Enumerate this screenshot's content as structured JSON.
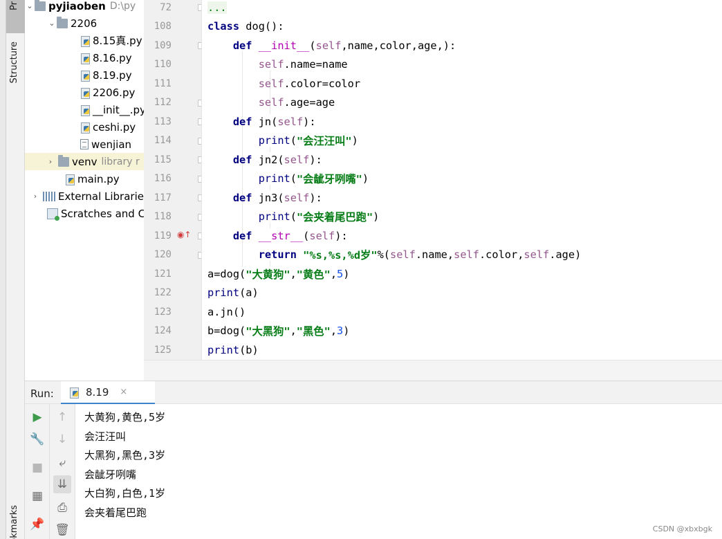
{
  "side_tabs": {
    "project": "Pr",
    "structure": "Structure",
    "bookmarks": "okmarks"
  },
  "project": {
    "root_name": "pyjiaoben",
    "root_path": "D:\\py",
    "folder_2206": "2206",
    "files": [
      "8.15真.py",
      "8.16.py",
      "8.19.py",
      "2206.py",
      "__init__.py",
      "ceshi.py",
      "wenjian"
    ],
    "venv": "venv",
    "venv_hint": "library r",
    "main": "main.py",
    "external": "External Librarie",
    "scratches": "Scratches and Co"
  },
  "editor": {
    "line_numbers": [
      "72",
      "108",
      "109",
      "110",
      "111",
      "112",
      "113",
      "114",
      "115",
      "116",
      "117",
      "118",
      "119",
      "120",
      "121",
      "122",
      "123",
      "124",
      "125"
    ],
    "lines": [
      [
        {
          "t": "...",
          "c": "dots"
        }
      ],
      [
        {
          "t": "class",
          "c": "kw"
        },
        {
          "t": " dog():",
          "c": ""
        }
      ],
      [
        {
          "t": "    ",
          "c": ""
        },
        {
          "t": "def",
          "c": "kw"
        },
        {
          "t": " ",
          "c": ""
        },
        {
          "t": "__init__",
          "c": "magic"
        },
        {
          "t": "(",
          "c": ""
        },
        {
          "t": "self",
          "c": "self"
        },
        {
          "t": ",name,color,age,):",
          "c": ""
        }
      ],
      [
        {
          "t": "        ",
          "c": ""
        },
        {
          "t": "self",
          "c": "self"
        },
        {
          "t": ".name=name",
          "c": ""
        }
      ],
      [
        {
          "t": "        ",
          "c": ""
        },
        {
          "t": "self",
          "c": "self"
        },
        {
          "t": ".color=color",
          "c": ""
        }
      ],
      [
        {
          "t": "        ",
          "c": ""
        },
        {
          "t": "self",
          "c": "self"
        },
        {
          "t": ".age=age",
          "c": ""
        }
      ],
      [
        {
          "t": "    ",
          "c": ""
        },
        {
          "t": "def",
          "c": "kw"
        },
        {
          "t": " jn(",
          "c": ""
        },
        {
          "t": "self",
          "c": "self"
        },
        {
          "t": "):",
          "c": ""
        }
      ],
      [
        {
          "t": "        ",
          "c": ""
        },
        {
          "t": "print",
          "c": "fn"
        },
        {
          "t": "(",
          "c": ""
        },
        {
          "t": "\"会汪汪叫\"",
          "c": "str"
        },
        {
          "t": ")",
          "c": ""
        }
      ],
      [
        {
          "t": "    ",
          "c": ""
        },
        {
          "t": "def",
          "c": "kw"
        },
        {
          "t": " jn2(",
          "c": ""
        },
        {
          "t": "self",
          "c": "self"
        },
        {
          "t": "):",
          "c": ""
        }
      ],
      [
        {
          "t": "        ",
          "c": ""
        },
        {
          "t": "print",
          "c": "fn"
        },
        {
          "t": "(",
          "c": ""
        },
        {
          "t": "\"会龇牙咧嘴\"",
          "c": "str"
        },
        {
          "t": ")",
          "c": ""
        }
      ],
      [
        {
          "t": "    ",
          "c": ""
        },
        {
          "t": "def",
          "c": "kw"
        },
        {
          "t": " jn3(",
          "c": ""
        },
        {
          "t": "self",
          "c": "self"
        },
        {
          "t": "):",
          "c": ""
        }
      ],
      [
        {
          "t": "        ",
          "c": ""
        },
        {
          "t": "print",
          "c": "fn"
        },
        {
          "t": "(",
          "c": ""
        },
        {
          "t": "\"会夹着尾巴跑\"",
          "c": "str"
        },
        {
          "t": ")",
          "c": ""
        }
      ],
      [
        {
          "t": "    ",
          "c": ""
        },
        {
          "t": "def",
          "c": "kw"
        },
        {
          "t": " ",
          "c": ""
        },
        {
          "t": "__str__",
          "c": "magic"
        },
        {
          "t": "(",
          "c": ""
        },
        {
          "t": "self",
          "c": "self"
        },
        {
          "t": "):",
          "c": ""
        }
      ],
      [
        {
          "t": "        ",
          "c": ""
        },
        {
          "t": "return",
          "c": "kw"
        },
        {
          "t": " ",
          "c": ""
        },
        {
          "t": "\"%s,%s,%d岁\"",
          "c": "str"
        },
        {
          "t": "%(",
          "c": ""
        },
        {
          "t": "self",
          "c": "self"
        },
        {
          "t": ".name,",
          "c": ""
        },
        {
          "t": "self",
          "c": "self"
        },
        {
          "t": ".color,",
          "c": ""
        },
        {
          "t": "self",
          "c": "self"
        },
        {
          "t": ".age)",
          "c": ""
        }
      ],
      [
        {
          "t": "a=dog(",
          "c": ""
        },
        {
          "t": "\"大黄狗\"",
          "c": "str"
        },
        {
          "t": ",",
          "c": ""
        },
        {
          "t": "\"黄色\"",
          "c": "str"
        },
        {
          "t": ",",
          "c": ""
        },
        {
          "t": "5",
          "c": "num"
        },
        {
          "t": ")",
          "c": ""
        }
      ],
      [
        {
          "t": "print",
          "c": "fn"
        },
        {
          "t": "(a)",
          "c": ""
        }
      ],
      [
        {
          "t": "a.jn()",
          "c": ""
        }
      ],
      [
        {
          "t": "b=dog(",
          "c": ""
        },
        {
          "t": "\"大黑狗\"",
          "c": "str"
        },
        {
          "t": ",",
          "c": ""
        },
        {
          "t": "\"黑色\"",
          "c": "str"
        },
        {
          "t": ",",
          "c": ""
        },
        {
          "t": "3",
          "c": "num"
        },
        {
          "t": ")",
          "c": ""
        }
      ],
      [
        {
          "t": "print",
          "c": "fn"
        },
        {
          "t": "(b)",
          "c": ""
        }
      ]
    ]
  },
  "run": {
    "label": "Run:",
    "tab_name": "8.19",
    "close_glyph": "×",
    "output": [
      "大黄狗,黄色,5岁",
      "会汪汪叫",
      "大黑狗,黑色,3岁",
      "会龇牙咧嘴",
      "大白狗,白色,1岁",
      "会夹着尾巴跑"
    ]
  },
  "watermark": "CSDN @xbxbgk"
}
